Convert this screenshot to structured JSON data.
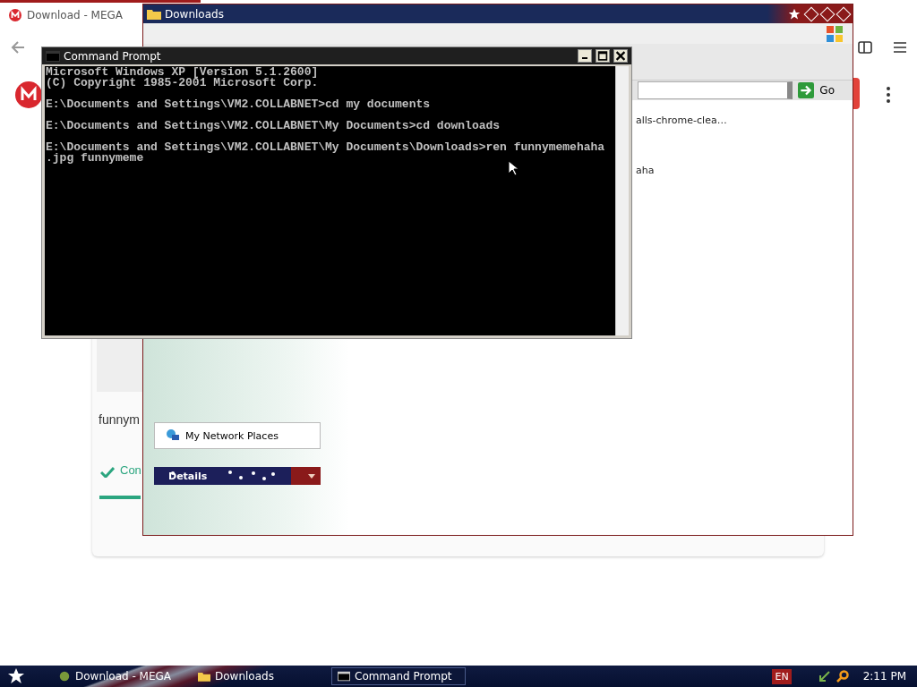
{
  "browser": {
    "tab_title": "Download - MEGA",
    "file_name": "funnym",
    "status_text": "Con"
  },
  "explorer": {
    "title": "Downloads",
    "go_button": "Go",
    "file_items": [
      "alls-chrome-clea…",
      "aha"
    ],
    "places": [
      "My Network Places"
    ],
    "details_header": "Details"
  },
  "command_prompt": {
    "title": "Command Prompt",
    "blocks": [
      [
        "Microsoft Windows XP [Version 5.1.2600]",
        "(C) Copyright 1985-2001 Microsoft Corp."
      ],
      [
        "E:\\Documents and Settings\\VM2.COLLABNET>cd my documents"
      ],
      [
        "E:\\Documents and Settings\\VM2.COLLABNET\\My Documents>cd downloads"
      ],
      [
        "E:\\Documents and Settings\\VM2.COLLABNET\\My Documents\\Downloads>ren funnymemehaha",
        ".jpg funnymeme"
      ]
    ]
  },
  "taskbar": {
    "buttons": [
      {
        "label": "Download - MEGA",
        "kind": "browser",
        "selected": false
      },
      {
        "label": "Downloads",
        "kind": "folder",
        "selected": false
      },
      {
        "label": "Command Prompt",
        "kind": "console",
        "selected": true
      }
    ],
    "language": "EN",
    "clock": "2:11 PM"
  }
}
